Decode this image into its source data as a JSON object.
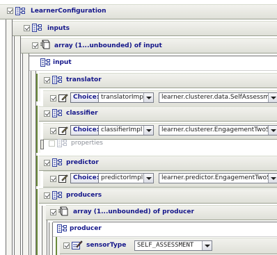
{
  "tree": {
    "root_label": "LearnerConfiguration",
    "inputs_label": "inputs",
    "array_input_label": "array (1...unbounded) of input",
    "input_label": "input",
    "translator_label": "translator",
    "translator_choice": {
      "button": "Choice:",
      "select_value": "translatorImpl",
      "class_value": "learner.clusterer.data.SelfAssessm"
    },
    "classifier_label": "classifier",
    "classifier_choice": {
      "button": "Choice:",
      "select_value": "classifierImpl",
      "class_value": "learner.clusterer.EngagementTwoS"
    },
    "properties_label": "properties",
    "predictor_label": "predictor",
    "predictor_choice": {
      "button": "Choice:",
      "select_value": "predictorImpl",
      "class_value": "learner.predictor.EngagementTwoS"
    },
    "producers_label": "producers",
    "array_producer_label": "array (1...unbounded) of producer",
    "producer_label": "producer",
    "sensor_type_label": "sensorType",
    "sensor_type_value": "SELF_ASSESSMENT"
  },
  "colors": {
    "label": "#14168a",
    "accent_green": "#6a8a3a",
    "element_icon": "#2a3a9a"
  }
}
